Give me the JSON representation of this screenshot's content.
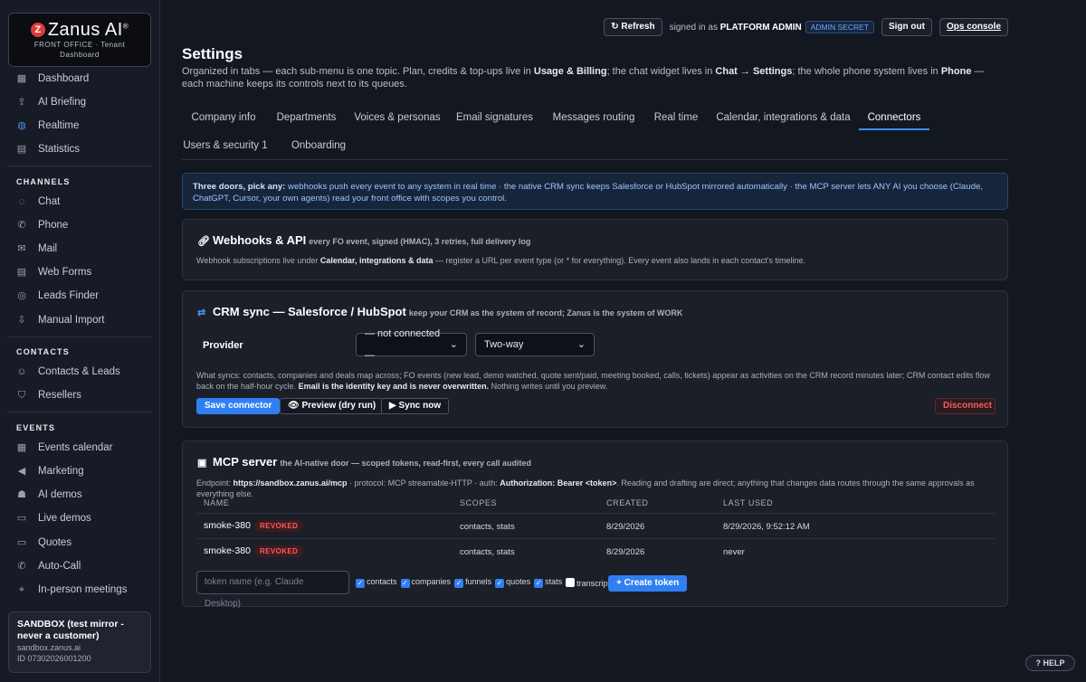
{
  "brand": {
    "name": "Zanus AI",
    "mark": "Z",
    "registered": "®",
    "subtitle_line1": "FRONT OFFICE · Tenant",
    "subtitle_line2": "Dashboard"
  },
  "sidebar": {
    "top_items": [
      {
        "label": "Dashboard",
        "icon": "dashboard-icon",
        "glyph": "▦"
      },
      {
        "label": "AI Briefing",
        "icon": "upload-icon",
        "glyph": "⇪"
      },
      {
        "label": "Realtime",
        "icon": "globe-icon",
        "glyph": "◍"
      },
      {
        "label": "Statistics",
        "icon": "document-icon",
        "glyph": "▤"
      }
    ],
    "sections": [
      {
        "heading": "CHANNELS",
        "items": [
          {
            "label": "Chat",
            "icon": "chat-icon",
            "glyph": "◌"
          },
          {
            "label": "Phone",
            "icon": "phone-icon",
            "glyph": "✆"
          },
          {
            "label": "Mail",
            "icon": "mail-icon",
            "glyph": "✉"
          },
          {
            "label": "Web Forms",
            "icon": "form-icon",
            "glyph": "▤"
          },
          {
            "label": "Leads Finder",
            "icon": "radar-icon",
            "glyph": "◎"
          },
          {
            "label": "Manual Import",
            "icon": "import-icon",
            "glyph": "⇩"
          }
        ]
      },
      {
        "heading": "CONTACTS",
        "items": [
          {
            "label": "Contacts & Leads",
            "icon": "users-icon",
            "glyph": "☺"
          },
          {
            "label": "Resellers",
            "icon": "handshake-icon",
            "glyph": "⛉"
          }
        ]
      },
      {
        "heading": "EVENTS",
        "items": [
          {
            "label": "Events calendar",
            "icon": "calendar-icon",
            "glyph": "▦"
          },
          {
            "label": "Marketing",
            "icon": "megaphone-icon",
            "glyph": "◀"
          },
          {
            "label": "AI demos",
            "icon": "robot-icon",
            "glyph": "☗"
          },
          {
            "label": "Live demos",
            "icon": "screen-icon",
            "glyph": "▭"
          },
          {
            "label": "Quotes",
            "icon": "money-icon",
            "glyph": "▭"
          },
          {
            "label": "Auto-Call",
            "icon": "phone-icon",
            "glyph": "✆"
          },
          {
            "label": "In-person meetings",
            "icon": "pin-icon",
            "glyph": "⌖"
          }
        ]
      }
    ],
    "sandbox": {
      "title": "SANDBOX (test mirror - never a customer)",
      "host": "sandbox.zanus.ai",
      "id": "ID 07302026001200"
    }
  },
  "topbar": {
    "refresh_label": "↻ Refresh",
    "signed_prefix": "signed in as",
    "user": "PLATFORM ADMIN",
    "admin_badge": "ADMIN SECRET",
    "signout_label": "Sign out",
    "ops_label": "Ops console"
  },
  "page": {
    "title": "Settings",
    "desc_1": "Organized in tabs — each sub-menu is one topic. Plan, credits & top-ups live in ",
    "desc_b1": "Usage & Billing",
    "desc_2": "; the chat widget lives in ",
    "desc_b2": "Chat → Settings",
    "desc_3": "; the whole phone system lives in ",
    "desc_b3": "Phone",
    "desc_4": " — each machine keeps its controls next to its queues."
  },
  "tabs": [
    {
      "label": "Company info"
    },
    {
      "label": "Departments"
    },
    {
      "label": "Voices & personas"
    },
    {
      "label": "Email signatures"
    },
    {
      "label": "Messages routing"
    },
    {
      "label": "Real time"
    },
    {
      "label": "Calendar, integrations & data"
    },
    {
      "label": "Connectors",
      "active": true
    },
    {
      "label": "Users & security 1"
    },
    {
      "label": "Onboarding"
    }
  ],
  "info": {
    "lead": "Three doors, pick any:",
    "text": " webhooks push every event to any system in real time · the native CRM sync keeps Salesforce or HubSpot mirrored automatically · the MCP server lets ANY AI you choose (Claude, ChatGPT, Cursor, your own agents) read your front office with scopes you control."
  },
  "webhooks": {
    "title": "Webhooks & API",
    "subtitle": "every FO event, signed (HMAC), 3 retries, full delivery log",
    "text_1": "Webhook subscriptions live under ",
    "text_b": "Calendar, integrations & data",
    "text_2": " — register a URL per event type (or * for everything). Every event also lands in each contact's timeline."
  },
  "crm": {
    "title": "CRM sync — Salesforce / HubSpot",
    "subtitle": "keep your CRM as the system of record; Zanus is the system of WORK",
    "provider_label": "Provider",
    "provider_value": "— not connected —",
    "direction_value": "Two-way",
    "help_1": "What syncs: contacts, companies and deals map across; FO events (new lead, demo watched, quote sent/paid, meeting booked, calls, tickets) appear as activities on the CRM record minutes later; CRM contact edits flow back on the half-hour cycle. ",
    "help_b": "Email is the identity key and is never overwritten.",
    "help_2": " Nothing writes until you preview.",
    "save_label": "Save connector",
    "preview_label": "Preview (dry run)",
    "sync_label": "▶ Sync now",
    "disconnect_label": "Disconnect"
  },
  "mcp": {
    "title": "MCP server",
    "subtitle": "the AI-native door — scoped tokens, read-first, every call audited",
    "endpoint_prefix": "Endpoint: ",
    "endpoint": "https://sandbox.zanus.ai/mcp",
    "endpoint_mid": " · protocol: MCP streamable-HTTP · auth: ",
    "auth": "Authorization: Bearer <token>",
    "endpoint_suffix": ". Reading and drafting are direct; anything that changes data routes through the same approvals as everything else.",
    "columns": [
      "NAME",
      "SCOPES",
      "CREATED",
      "LAST USED"
    ],
    "rows": [
      {
        "name": "smoke-380",
        "status": "REVOKED",
        "scopes": "contacts, stats",
        "created": "8/29/2026",
        "last_used": "8/29/2026, 9:52:12 AM"
      },
      {
        "name": "smoke-380",
        "status": "REVOKED",
        "scopes": "contacts, stats",
        "created": "8/29/2026",
        "last_used": "never"
      }
    ],
    "token_placeholder": "token name (e.g. Claude Desktop)",
    "scopes": [
      {
        "label": "contacts",
        "checked": true
      },
      {
        "label": "companies",
        "checked": true
      },
      {
        "label": "funnels",
        "checked": true
      },
      {
        "label": "quotes",
        "checked": true
      },
      {
        "label": "stats",
        "checked": true
      },
      {
        "label": "transcripts",
        "checked": false
      }
    ],
    "create_label": "+ Create token"
  },
  "help_label": "? HELP"
}
